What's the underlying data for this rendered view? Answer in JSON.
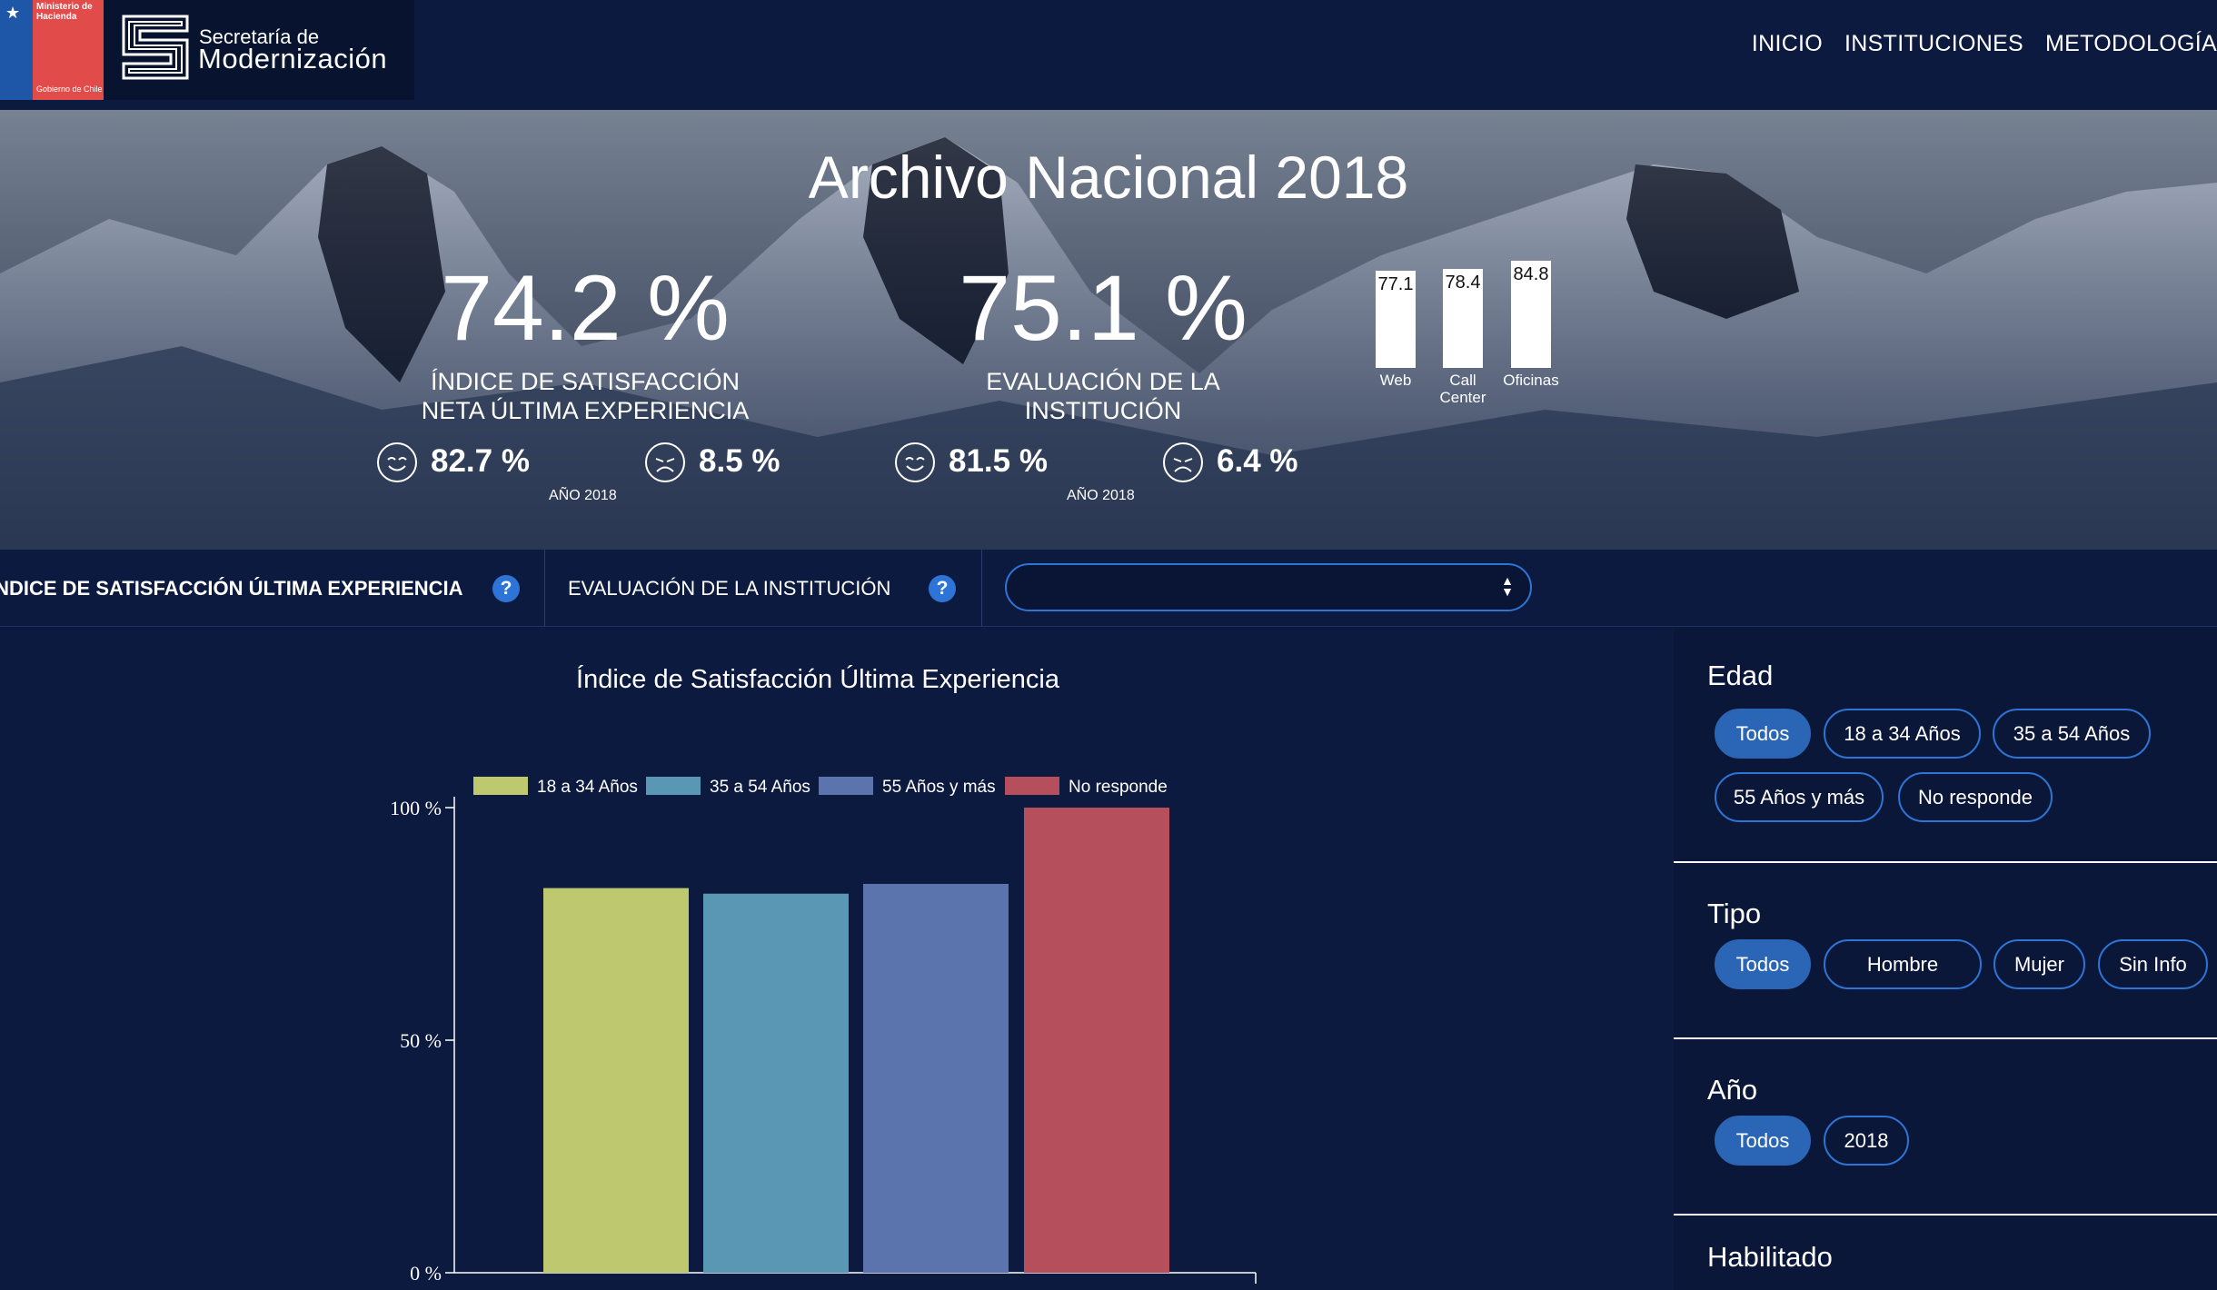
{
  "header": {
    "gov_logo": {
      "ministry": "Ministerio de Hacienda",
      "government": "Gobierno de Chile"
    },
    "sec_logo": {
      "small": "Secretaría de",
      "big": "Modernización"
    },
    "nav": [
      "INICIO",
      "INSTITUCIONES",
      "METODOLOGÍA"
    ]
  },
  "hero": {
    "title": "Archivo Nacional 2018",
    "kpi1": {
      "value": "74.2 %",
      "label_line1": "ÍNDICE DE SATISFACCIÓN",
      "label_line2": "NETA ÚLTIMA EXPERIENCIA",
      "happy": "82.7 %",
      "sad": "8.5 %",
      "year": "AÑO 2018"
    },
    "kpi2": {
      "value": "75.1 %",
      "label_line1": "EVALUACIÓN DE LA",
      "label_line2": "INSTITUCIÓN",
      "happy": "81.5 %",
      "sad": "6.4 %",
      "year": "AÑO 2018"
    },
    "channels": [
      {
        "label_line1": "Web",
        "label_line2": "",
        "value": "77.1"
      },
      {
        "label_line1": "Call",
        "label_line2": "Center",
        "value": "78.4"
      },
      {
        "label_line1": "Oficinas",
        "label_line2": "",
        "value": "84.8"
      }
    ]
  },
  "tabs": {
    "tab1": "ÍNDICE DE SATISFACCIÓN ÚLTIMA EXPERIENCIA",
    "tab2": "EVALUACIÓN DE LA INSTITUCIÓN",
    "help": "?",
    "select_value": ""
  },
  "chart_data": {
    "type": "bar",
    "title": "Índice de Satisfacción Última Experiencia",
    "categories": [
      "18 a 34 Años",
      "35 a 54 Años",
      "55 Años y más",
      "No responde"
    ],
    "values": [
      82.7,
      81.5,
      83.6,
      100
    ],
    "colors": [
      "#bec96f",
      "#5a97b4",
      "#5b74ae",
      "#b64f5c"
    ],
    "yticks": [
      "0 %",
      "50 %",
      "100 %"
    ],
    "ylim": [
      0,
      100
    ],
    "legend_position": "top"
  },
  "filters": {
    "edad": {
      "title": "Edad",
      "options": [
        "Todos",
        "18 a 34 Años",
        "35 a 54 Años",
        "55 Años y más",
        "No responde"
      ],
      "active": "Todos"
    },
    "tipo": {
      "title": "Tipo",
      "options": [
        "Todos",
        "Hombre",
        "Mujer",
        "Sin Info"
      ],
      "active": "Todos"
    },
    "anio": {
      "title": "Año",
      "options": [
        "Todos",
        "2018"
      ],
      "active": "Todos"
    },
    "habilitado": {
      "title": "Habilitado"
    }
  }
}
